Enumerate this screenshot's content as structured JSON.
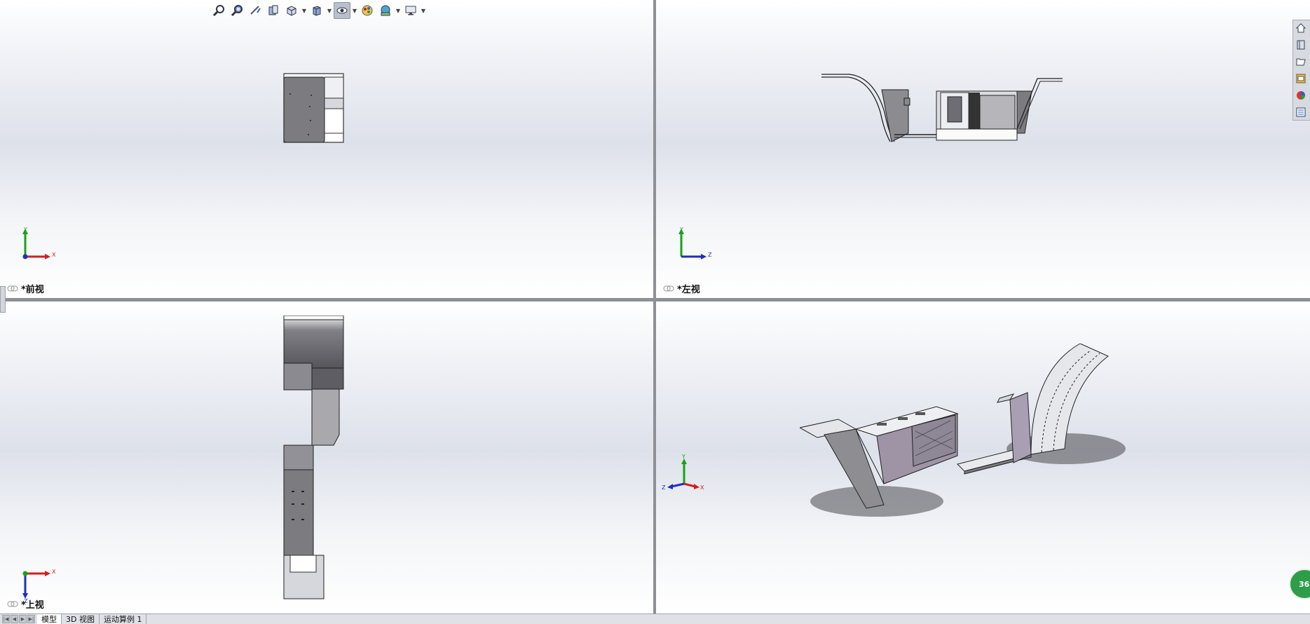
{
  "toolbar": {
    "items": [
      "zoom-to-fit-icon",
      "zoom-to-area-icon",
      "previous-view-icon",
      "section-view-icon",
      "view-orientation-icon",
      "display-style-icon",
      "hide-show-items-icon",
      "edit-appearance-icon",
      "apply-scene-icon",
      "view-settings-icon"
    ],
    "active": "hide-show-items-icon"
  },
  "viewports": {
    "front": {
      "label": "*前视",
      "axes": [
        "Y",
        "X"
      ]
    },
    "left": {
      "label": "*左视",
      "axes": [
        "Y",
        "Z"
      ]
    },
    "top": {
      "label": "*上视",
      "axes": [
        "X",
        "Z"
      ]
    },
    "iso": {
      "axes": [
        "Y",
        "Z",
        "X"
      ]
    }
  },
  "task_pane": {
    "items": [
      "home-icon",
      "design-library-icon",
      "file-explorer-icon",
      "view-palette-icon",
      "appearances-icon",
      "custom-properties-icon"
    ]
  },
  "badge": {
    "text": "36"
  },
  "tabs": {
    "items": [
      "模型",
      "3D 视图",
      "运动算例 1"
    ],
    "active": "模型"
  },
  "colors": {
    "axis_x": "#d21f1f",
    "axis_y": "#18a218",
    "axis_z": "#1f2fb8",
    "model_gray": "#7c7c80",
    "model_purple": "#a89bb0"
  }
}
